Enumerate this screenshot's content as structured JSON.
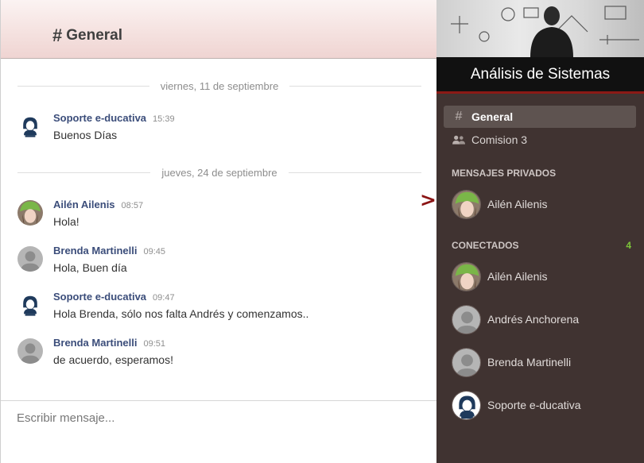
{
  "header": {
    "hash": "#",
    "channel": "General"
  },
  "messages": {
    "dividers": [
      "viernes, 11 de septiembre",
      "jueves, 24 de septiembre"
    ],
    "items": [
      {
        "author": "Soporte e-ducativa",
        "time": "15:39",
        "text": "Buenos Días",
        "avatar": "admin-avatar"
      },
      {
        "author": "Ailén Ailenis",
        "time": "08:57",
        "text": "Hola!",
        "avatar": "green-hat-avatar"
      },
      {
        "author": "Brenda Martinelli",
        "time": "09:45",
        "text": "Hola, Buen día",
        "avatar": "default-avatar"
      },
      {
        "author": "Soporte e-ducativa",
        "time": "09:47",
        "text": "Hola Brenda, sólo nos falta Andrés y comenzamos..",
        "avatar": "admin-avatar"
      },
      {
        "author": "Brenda Martinelli",
        "time": "09:51",
        "text": "de acuerdo, esperamos!",
        "avatar": "default-avatar"
      }
    ]
  },
  "composer": {
    "placeholder": "Escribir mensaje..."
  },
  "indicator": ">",
  "sidebar": {
    "course_title": "Análisis de Sistemas",
    "channels": [
      {
        "icon": "hash-icon",
        "label": "General",
        "active": true
      },
      {
        "icon": "users-icon",
        "label": "Comision 3",
        "active": false
      }
    ],
    "private_heading": "MENSAJES PRIVADOS",
    "private": [
      {
        "name": "Ailén Ailenis",
        "avatar": "green-hat-avatar"
      }
    ],
    "connected_heading": "CONECTADOS",
    "connected_count": "4",
    "connected": [
      {
        "name": "Ailén Ailenis",
        "avatar": "green-hat-avatar"
      },
      {
        "name": "Andrés Anchorena",
        "avatar": "default-avatar"
      },
      {
        "name": "Brenda Martinelli",
        "avatar": "default-avatar"
      },
      {
        "name": "Soporte e-ducativa",
        "avatar": "admin-avatar"
      }
    ]
  },
  "colors": {
    "sidebar_bg": "#403331",
    "accent_red": "#8b1a16",
    "author_blue": "#3b4d7a",
    "online_green": "#7cc43a"
  }
}
